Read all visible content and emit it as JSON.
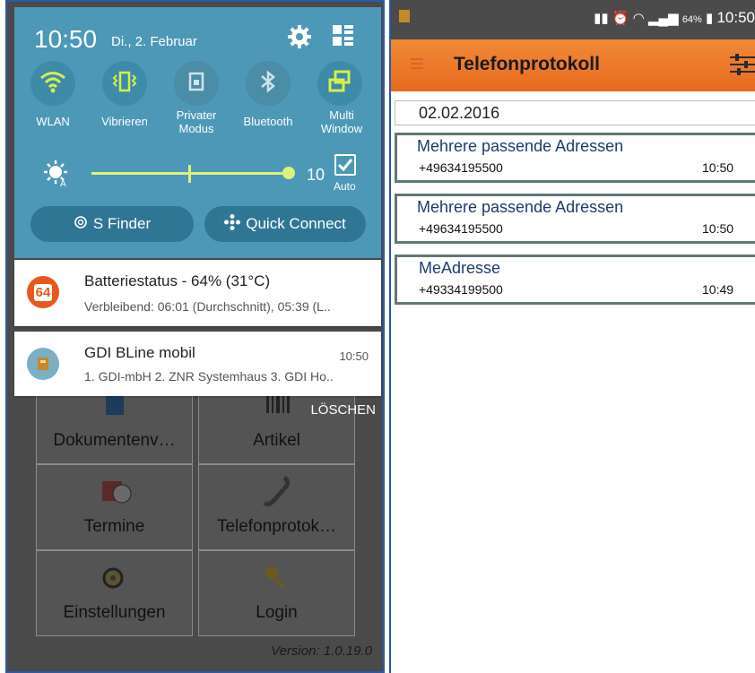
{
  "left": {
    "shade": {
      "time": "10:50",
      "date": "Di., 2. Februar",
      "settings_icon": "gear-icon",
      "edit_icon": "grid-edit-icon",
      "quick_toggles": [
        {
          "label": "WLAN",
          "icon": "wifi-icon",
          "active": true
        },
        {
          "label": "Vibrieren",
          "icon": "vibrate-icon",
          "active": true
        },
        {
          "label": "Privater Modus",
          "icon": "private-mode-icon",
          "active": false
        },
        {
          "label": "Bluetooth",
          "icon": "bluetooth-icon",
          "active": false
        },
        {
          "label": "Multi Window",
          "icon": "multi-window-icon",
          "active": true
        }
      ],
      "brightness_value": "10",
      "auto_label": "Auto",
      "auto_checked": true,
      "s_finder": "S Finder",
      "quick_connect": "Quick Connect"
    },
    "notifications": [
      {
        "title": "Batteriestatus - 64% (31°C)",
        "text": "Verbleibend: 06:01 (Durchschnitt), 05:39 (L..",
        "time": "",
        "badge": "64"
      },
      {
        "title": "GDI BLine mobil",
        "text": "1. GDI-mbH 2. ZNR Systemhaus 3. GDI Ho..",
        "time": "10:50",
        "badge": ""
      }
    ],
    "clear_label": "LÖSCHEN",
    "app_tiles": [
      "Dokumentenv…",
      "Artikel",
      "Termine",
      "Telefonprotok…",
      "Einstellungen",
      "Login"
    ],
    "version": "Version: 1.0.19.0"
  },
  "right": {
    "status": {
      "battery": "64%",
      "time": "10:50"
    },
    "toolbar_title": "Telefonprotokoll",
    "date": "02.02.2016",
    "calls": [
      {
        "name": "Mehrere passende Adressen",
        "number": "+49634195500",
        "time": "10:50"
      },
      {
        "name": "Mehrere passende Adressen",
        "number": "+49634195500",
        "time": "10:50"
      },
      {
        "name": "MeAdresse",
        "number": "+49334199500",
        "time": "10:49"
      }
    ]
  },
  "colors": {
    "shade_bg": "#4d98b6",
    "toggle_active": "#d4f04a",
    "toolbar_orange": "#ec7728",
    "card_border": "#5e7a72",
    "call_name": "#1e3a72"
  }
}
